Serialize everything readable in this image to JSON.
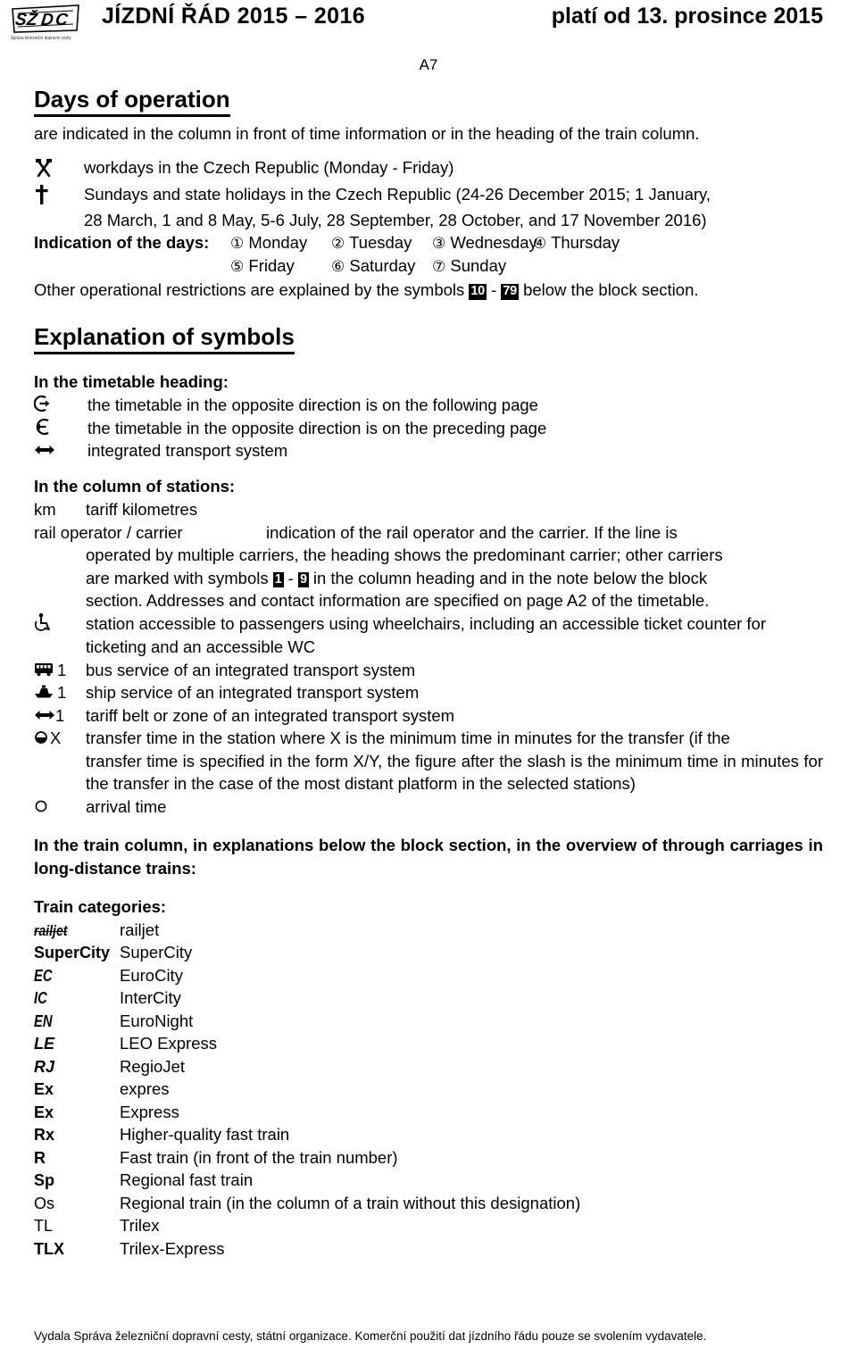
{
  "header": {
    "logo_text": "SŽDC",
    "logo_subtitle": "Správa železniční dopravní cesty",
    "title": "JÍZDNÍ  ŘÁD  2015 – 2016",
    "validity": "platí od 13. prosince 2015"
  },
  "page_code": "A7",
  "days": {
    "title": "Days of operation",
    "intro": "are indicated in the column in front of time information or in the heading of the train column.",
    "entries": [
      {
        "symbol": "crossed-hammers-icon",
        "text": "workdays in the Czech Republic (Monday - Friday)"
      },
      {
        "symbol": "dagger-icon",
        "text": "Sundays and state holidays in the Czech Republic (24-26 December 2015; 1 January,",
        "cont": "28 March, 1 and 8 May, 5-6 July, 28 September, 28 October, and 17 November 2016)"
      }
    ],
    "indication_label": "Indication of the days:",
    "day_items": [
      {
        "num": "①",
        "label": "Monday"
      },
      {
        "num": "②",
        "label": "Tuesday"
      },
      {
        "num": "③",
        "label": "Wednesday"
      },
      {
        "num": "④",
        "label": "Thursday"
      },
      {
        "num": "⑤",
        "label": "Friday"
      },
      {
        "num": "⑥",
        "label": "Saturday"
      },
      {
        "num": "⑦",
        "label": "Sunday"
      }
    ],
    "other_restrictions_pre": "Other operational restrictions are explained by the symbols ",
    "other_restrictions_from": "10",
    "other_restrictions_dash": " - ",
    "other_restrictions_to": "79",
    "other_restrictions_post": " below the block section."
  },
  "symbols": {
    "title": "Explanation of symbols",
    "timetable_heading": {
      "group": "In the timetable heading:",
      "rows": [
        {
          "symbol": "circle-arrow-right-icon",
          "text": "the timetable in the opposite direction is on the following page"
        },
        {
          "symbol": "circle-arrow-left-icon",
          "text": "the timetable in the opposite direction is on the preceding page"
        },
        {
          "symbol": "double-arrow-icon",
          "text": "integrated transport system"
        }
      ]
    },
    "station_column": {
      "group": "In the column of stations:",
      "km_symbol": "km",
      "km_text": "tariff kilometres",
      "operator_symbol": "rail operator / carrier",
      "operator_text_1": "indication of the rail operator and the carrier. If the line is",
      "operator_text_2": "operated by multiple carriers, the heading shows the predominant carrier; other carriers",
      "operator_text_3a": "are marked with symbols ",
      "operator_box_from": "1",
      "operator_box_dash": " - ",
      "operator_box_to": "9",
      "operator_text_3b": " in the column heading and in the note below the block",
      "operator_text_4": "section. Addresses and contact information are specified on page A2 of the timetable.",
      "rows": [
        {
          "symbol": "wheelchair-icon",
          "suffix": "",
          "text": "station accessible to passengers using wheelchairs, including an accessible ticket counter for",
          "cont": "ticketing and an accessible WC"
        },
        {
          "symbol": "bus-icon",
          "suffix": "1",
          "text": "bus service of an integrated transport system",
          "cont": ""
        },
        {
          "symbol": "ship-icon",
          "suffix": "1",
          "text": "ship service of an integrated transport system",
          "cont": ""
        },
        {
          "symbol": "double-arrow-icon",
          "suffix": "1",
          "text": "tariff belt or zone of an integrated transport system",
          "cont": ""
        },
        {
          "symbol": "half-filled-circle-icon",
          "suffix": "X",
          "text": "transfer time in the station where X is the minimum time in minutes for the transfer (if the",
          "cont": "transfer time is specified in the form X/Y, the figure after the slash is the minimum time in minutes for the transfer in the case of the most distant platform in the selected stations)"
        },
        {
          "symbol": "open-circle-icon",
          "suffix": "",
          "text": "arrival time",
          "cont": ""
        }
      ]
    },
    "train_column": {
      "intro": "In the train column, in explanations below the block section, in the overview of through carriages in long-distance trains:",
      "categories_head": "Train categories:",
      "categories": [
        {
          "code": "railjet",
          "style": "railjet",
          "name": "railjet"
        },
        {
          "code": "SuperCity",
          "style": "b",
          "name": "SuperCity"
        },
        {
          "code": "EC",
          "style": "bi",
          "name": "EuroCity"
        },
        {
          "code": "IC",
          "style": "bi",
          "name": "InterCity"
        },
        {
          "code": "EN",
          "style": "bi",
          "name": "EuroNight"
        },
        {
          "code": "LE",
          "style": "rj-style",
          "name": "LEO Express"
        },
        {
          "code": "RJ",
          "style": "rj-style",
          "name": "RegioJet"
        },
        {
          "code": "Ex",
          "style": "b",
          "name": "expres"
        },
        {
          "code": "Ex",
          "style": "b",
          "name": "Express"
        },
        {
          "code": "Rx",
          "style": "b",
          "name": "Higher-quality fast train"
        },
        {
          "code": "R",
          "style": "b",
          "name": "Fast train (in front of the train number)"
        },
        {
          "code": "Sp",
          "style": "b",
          "name": "Regional fast train"
        },
        {
          "code": "Os",
          "style": "plain",
          "name": "Regional train (in the column of a train without this designation)"
        },
        {
          "code": "TL",
          "style": "plain",
          "name": "Trilex"
        },
        {
          "code": "TLX",
          "style": "b",
          "name": "Trilex-Express"
        }
      ]
    }
  },
  "footer": {
    "text": "Vydala Správa železniční dopravní cesty, státní organizace. Komerční použití dat jízdního řádu pouze se svolením vydavatele."
  }
}
